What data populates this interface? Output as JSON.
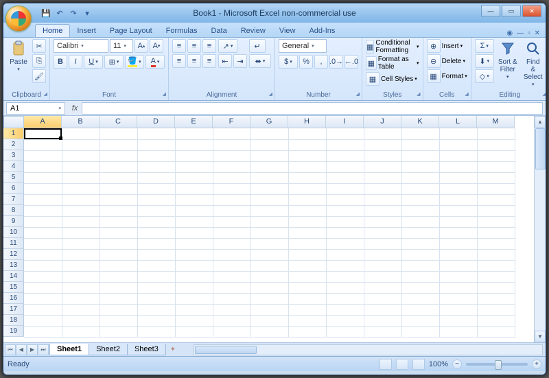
{
  "title": "Book1 - Microsoft Excel non-commercial use",
  "tabs": [
    "Home",
    "Insert",
    "Page Layout",
    "Formulas",
    "Data",
    "Review",
    "View",
    "Add-Ins"
  ],
  "active_tab": "Home",
  "ribbon": {
    "clipboard": {
      "paste": "Paste",
      "label": "Clipboard"
    },
    "font": {
      "name": "Calibri",
      "size": "11",
      "label": "Font"
    },
    "alignment": {
      "label": "Alignment"
    },
    "number": {
      "format": "General",
      "label": "Number"
    },
    "styles": {
      "cond": "Conditional Formatting",
      "table": "Format as Table",
      "cell": "Cell Styles",
      "label": "Styles"
    },
    "cells": {
      "insert": "Insert",
      "delete": "Delete",
      "format": "Format",
      "label": "Cells"
    },
    "editing": {
      "sort": "Sort & Filter",
      "find": "Find & Select",
      "label": "Editing"
    }
  },
  "namebox": "A1",
  "columns": [
    "A",
    "B",
    "C",
    "D",
    "E",
    "F",
    "G",
    "H",
    "I",
    "J",
    "K",
    "L",
    "M"
  ],
  "rows": [
    1,
    2,
    3,
    4,
    5,
    6,
    7,
    8,
    9,
    10,
    11,
    12,
    13,
    14,
    15,
    16,
    17,
    18,
    19
  ],
  "active_cell": "A1",
  "sheets": [
    "Sheet1",
    "Sheet2",
    "Sheet3"
  ],
  "active_sheet": "Sheet1",
  "status": "Ready",
  "zoom": "100%"
}
